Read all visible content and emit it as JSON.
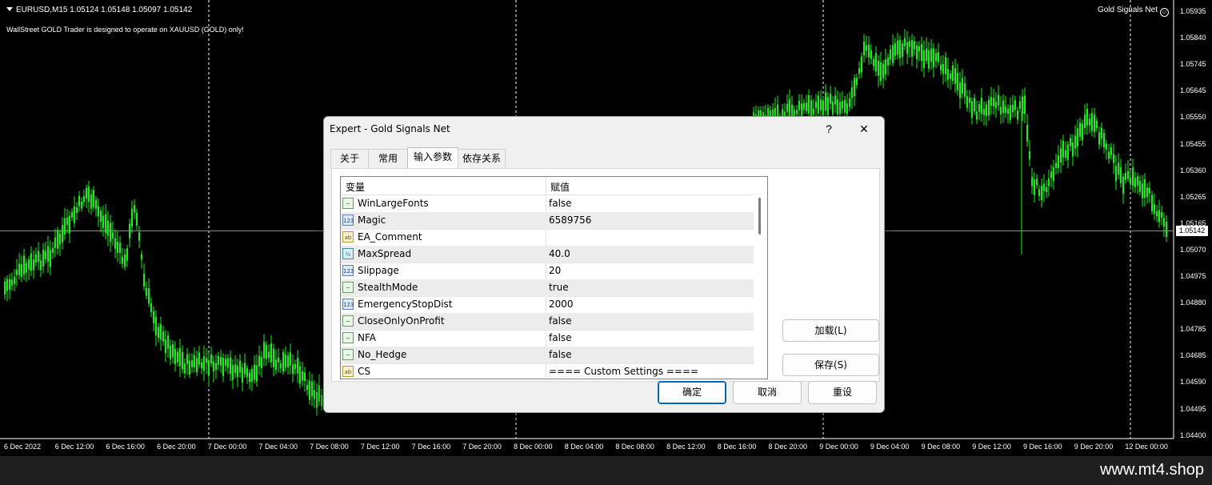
{
  "chart": {
    "symbol_info": "EURUSD,M15  1.05124 1.05148 1.05097 1.05142",
    "notice": "WallStreet GOLD Trader is designed to operate on XAUUSD (GOLD) only!",
    "ea_label": "Gold Signals Net",
    "current_price": "1.05142",
    "price_labels": [
      "1.05935",
      "1.05840",
      "1.05745",
      "1.05645",
      "1.05550",
      "1.05455",
      "1.05360",
      "1.05265",
      "1.05165",
      "1.05070",
      "1.04975",
      "1.04880",
      "1.04785",
      "1.04685",
      "1.04590",
      "1.04495",
      "1.04400"
    ],
    "time_labels": [
      "6 Dec 2022",
      "6 Dec 12:00",
      "6 Dec 16:00",
      "6 Dec 20:00",
      "7 Dec 00:00",
      "7 Dec 04:00",
      "7 Dec 08:00",
      "7 Dec 12:00",
      "7 Dec 16:00",
      "7 Dec 20:00",
      "8 Dec 00:00",
      "8 Dec 04:00",
      "8 Dec 08:00",
      "8 Dec 12:00",
      "8 Dec 16:00",
      "8 Dec 20:00",
      "9 Dec 00:00",
      "9 Dec 04:00",
      "9 Dec 08:00",
      "9 Dec 12:00",
      "9 Dec 16:00",
      "9 Dec 20:00",
      "12 Dec 00:00"
    ],
    "candle_color": "#00ff00"
  },
  "dialog": {
    "title": "Expert - Gold Signals Net",
    "help_glyph": "?",
    "close_glyph": "✕",
    "tabs": [
      {
        "label": "关于",
        "active": false
      },
      {
        "label": "常用",
        "active": false
      },
      {
        "label": "输入参数",
        "active": true
      },
      {
        "label": "依存关系",
        "active": false
      }
    ],
    "grid": {
      "col_variable": "变量",
      "col_value": "赋值",
      "rows": [
        {
          "icon": "bool-icon",
          "icon_text": "~",
          "name": "WinLargeFonts",
          "value": "false"
        },
        {
          "icon": "int-icon",
          "icon_text": "123",
          "name": "Magic",
          "value": "6589756"
        },
        {
          "icon": "string-icon",
          "icon_text": "ab",
          "name": "EA_Comment",
          "value": ""
        },
        {
          "icon": "double-icon",
          "icon_text": "½",
          "name": "MaxSpread",
          "value": "40.0"
        },
        {
          "icon": "int-icon",
          "icon_text": "123",
          "name": "Slippage",
          "value": "20"
        },
        {
          "icon": "bool-icon",
          "icon_text": "~",
          "name": "StealthMode",
          "value": "true"
        },
        {
          "icon": "int-icon",
          "icon_text": "123",
          "name": "EmergencyStopDist",
          "value": "2000"
        },
        {
          "icon": "bool-icon",
          "icon_text": "~",
          "name": "CloseOnlyOnProfit",
          "value": "false"
        },
        {
          "icon": "bool-icon",
          "icon_text": "~",
          "name": "NFA",
          "value": "false"
        },
        {
          "icon": "bool-icon",
          "icon_text": "~",
          "name": "No_Hedge",
          "value": "false"
        },
        {
          "icon": "string-icon",
          "icon_text": "ab",
          "name": "CS",
          "value": "==== Custom Settings ===="
        }
      ]
    },
    "load_label": "加载(L)",
    "save_label": "保存(S)",
    "ok_label": "确定",
    "cancel_label": "取消",
    "reset_label": "重设"
  },
  "footer": {
    "site": "www.mt4.shop"
  }
}
